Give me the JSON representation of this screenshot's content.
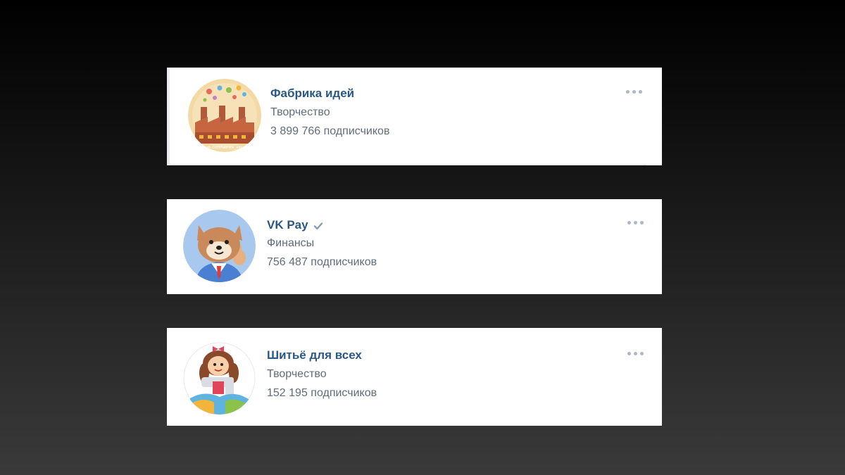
{
  "communities": [
    {
      "name": "Фабрика идей",
      "category": "Творчество",
      "subscribers": "3 899 766 подписчиков",
      "verified": false,
      "avatar_icon": "factory-avatar",
      "avatar_watermark": "vk.com/fabrika_idei"
    },
    {
      "name": "VK Pay",
      "category": "Финансы",
      "subscribers": "756 487 подписчиков",
      "verified": true,
      "avatar_icon": "dog-mascot-avatar"
    },
    {
      "name": "Шитьё для всех",
      "category": "Творчество",
      "subscribers": "152 195 подписчиков",
      "verified": false,
      "avatar_icon": "sewing-girl-avatar"
    }
  ],
  "colors": {
    "name_link": "#2a5885",
    "meta_text": "#626d7a",
    "dots": "#aeb7c2",
    "verified": "#8a9bb3"
  }
}
